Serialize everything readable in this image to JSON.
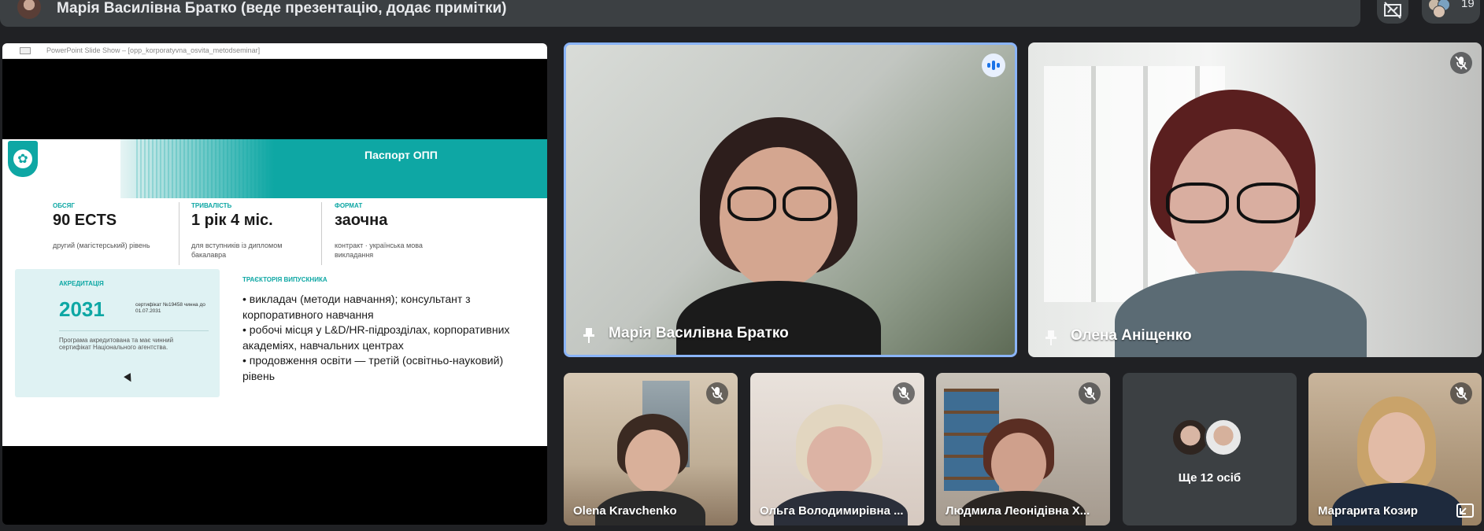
{
  "header": {
    "presenter_title": "Марія Василівна Братко (веде презентацію, додає примітки)",
    "participant_count": "19"
  },
  "presentation": {
    "window_title": "PowerPoint Slide Show – [opp_korporatyvna_osvita_metodseminar]",
    "slide": {
      "heading": "Паспорт ОПП",
      "stats": [
        {
          "label": "ОБСЯГ",
          "value": "90 ECTS",
          "sub": "другий (магістерський) рівень"
        },
        {
          "label": "ТРИВАЛІСТЬ",
          "value": "1 рік 4 міс.",
          "sub": "для вступників із дипломом бакалавра"
        },
        {
          "label": "ФОРМАТ",
          "value": "заочна",
          "sub": "контракт · українська мова викладання"
        }
      ],
      "accreditation": {
        "label": "АКРЕДИТАЦІЯ",
        "year": "2031",
        "cert": "сертифікат №19458 чинна до 01.07.2031",
        "note": "Програма акредитована та має чинний сертифікат Національного агентства."
      },
      "trajectory": {
        "label": "ТРАЄКТОРІЯ ВИПУСКНИКА",
        "items": [
          "• викладач (методи навчання); консультант з корпоративного навчання",
          "• робочі місця у L&D/HR-підрозділах, корпоративних академіях, навчальних центрах",
          "• продовження освіти — третій (освітньо-науковий) рівень"
        ]
      }
    }
  },
  "participants": {
    "main": [
      {
        "name": "Марія Василівна Братко",
        "speaking": true,
        "pinned": true
      },
      {
        "name": "Олена Аніщенко",
        "muted": true
      }
    ],
    "small": [
      {
        "name": "Olena Kravchenko",
        "muted": true
      },
      {
        "name": "Ольга Володимирівна ...",
        "muted": true
      },
      {
        "name": "Людмила Леонідівна Х...",
        "muted": true
      },
      {
        "name": "Маргарита Козир",
        "muted": true
      }
    ],
    "more": "Ще 12 осіб"
  },
  "colors": {
    "accent": "#0ea7a4",
    "speaking_border": "#8ab4f8",
    "tile_bg": "#3c4043",
    "app_bg": "#202124"
  },
  "icons": {
    "pin": "pin-icon",
    "muted_mic": "mic-off-icon",
    "speaking": "audio-level-icon",
    "slash_no_presenter": "presentation-off-icon"
  }
}
